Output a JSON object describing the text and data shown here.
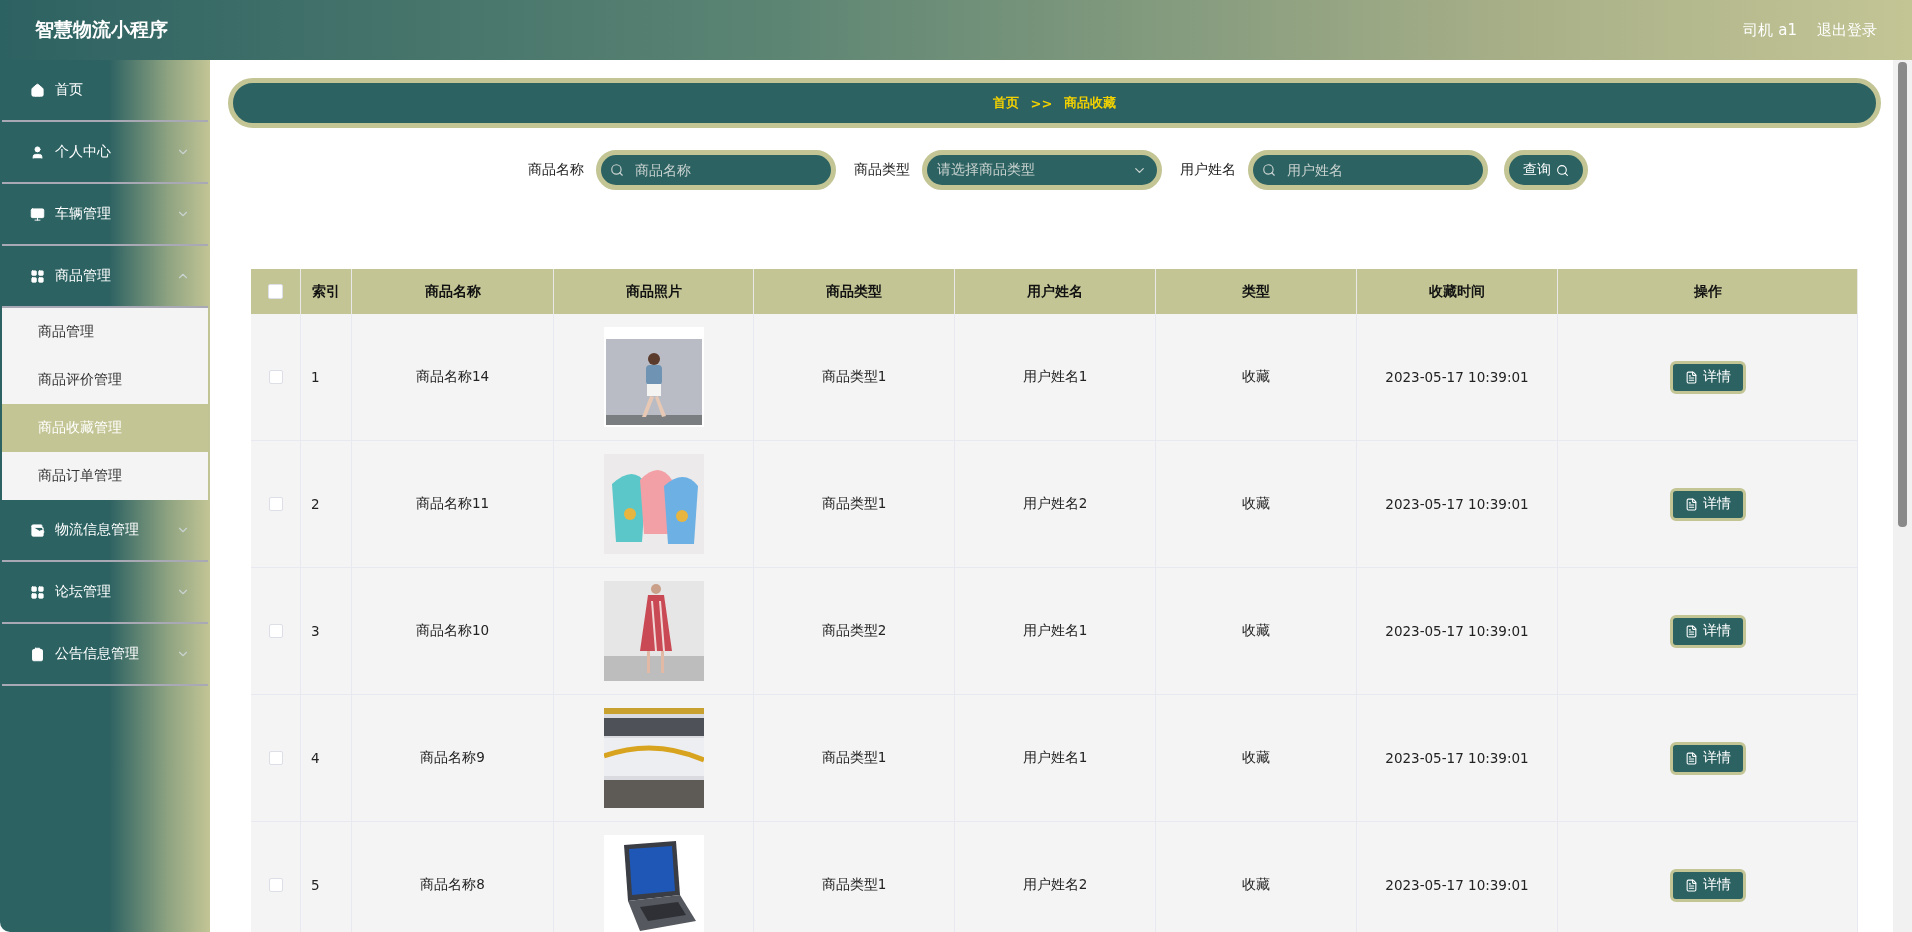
{
  "header": {
    "title": "智慧物流小程序",
    "user": "司机 a1",
    "logout": "退出登录"
  },
  "sidebar": {
    "items": [
      {
        "label": "首页",
        "expandable": false
      },
      {
        "label": "个人中心",
        "expandable": true,
        "expanded": false
      },
      {
        "label": "车辆管理",
        "expandable": true,
        "expanded": false
      },
      {
        "label": "商品管理",
        "expandable": true,
        "expanded": true,
        "children": [
          {
            "label": "商品管理",
            "selected": false
          },
          {
            "label": "商品评价管理",
            "selected": false
          },
          {
            "label": "商品收藏管理",
            "selected": true
          },
          {
            "label": "商品订单管理",
            "selected": false
          }
        ]
      },
      {
        "label": "物流信息管理",
        "expandable": true,
        "expanded": false
      },
      {
        "label": "论坛管理",
        "expandable": true,
        "expanded": false
      },
      {
        "label": "公告信息管理",
        "expandable": true,
        "expanded": false
      }
    ]
  },
  "breadcrumb": {
    "home": "首页",
    "separator": ">>",
    "current": "商品收藏"
  },
  "search": {
    "fields": [
      {
        "kind": "text",
        "label": "商品名称",
        "placeholder": "商品名称"
      },
      {
        "kind": "select",
        "label": "商品类型",
        "placeholder": "请选择商品类型"
      },
      {
        "kind": "text",
        "label": "用户姓名",
        "placeholder": "用户姓名"
      }
    ],
    "button": "查询"
  },
  "table": {
    "select_all_checked": false,
    "columns": [
      "索引",
      "商品名称",
      "商品照片",
      "商品类型",
      "用户姓名",
      "类型",
      "收藏时间",
      "操作"
    ],
    "rows": [
      {
        "checked": false,
        "index": "1",
        "name": "商品名称14",
        "type": "商品类型1",
        "user": "用户姓名1",
        "kind": "收藏",
        "time": "2023-05-17 10:39:01",
        "action": "详情"
      },
      {
        "checked": false,
        "index": "2",
        "name": "商品名称11",
        "type": "商品类型1",
        "user": "用户姓名2",
        "kind": "收藏",
        "time": "2023-05-17 10:39:01",
        "action": "详情"
      },
      {
        "checked": false,
        "index": "3",
        "name": "商品名称10",
        "type": "商品类型2",
        "user": "用户姓名1",
        "kind": "收藏",
        "time": "2023-05-17 10:39:01",
        "action": "详情"
      },
      {
        "checked": false,
        "index": "4",
        "name": "商品名称9",
        "type": "商品类型1",
        "user": "用户姓名1",
        "kind": "收藏",
        "time": "2023-05-17 10:39:01",
        "action": "详情"
      },
      {
        "checked": false,
        "index": "5",
        "name": "商品名称8",
        "type": "商品类型1",
        "user": "用户姓名2",
        "kind": "收藏",
        "time": "2023-05-17 10:39:01",
        "action": "详情"
      }
    ]
  }
}
